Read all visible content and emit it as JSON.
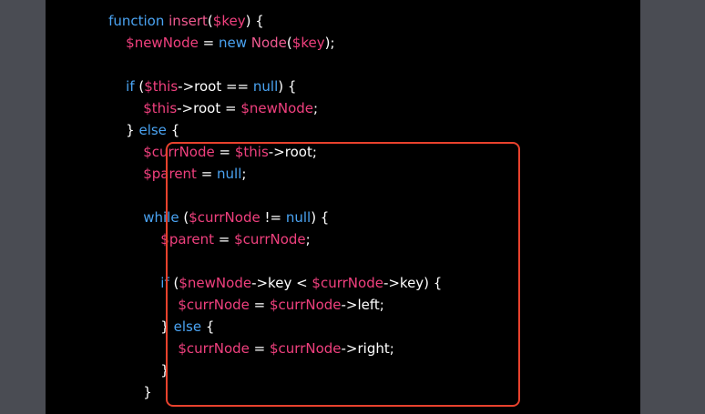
{
  "colors": {
    "background": "#4a4c53",
    "panel": "#000000",
    "keyword": "#4aa3f2",
    "function": "#f05a91",
    "variable": "#f0407e",
    "text": "#ffffff",
    "highlight_border": "#e8422d"
  },
  "code": {
    "lines": [
      {
        "indent": "    ",
        "tokens": [
          {
            "t": "function",
            "c": "kw"
          },
          {
            "t": " ",
            "c": "plain"
          },
          {
            "t": "insert",
            "c": "fn"
          },
          {
            "t": "(",
            "c": "plain"
          },
          {
            "t": "$key",
            "c": "var"
          },
          {
            "t": ") {",
            "c": "plain"
          }
        ]
      },
      {
        "indent": "        ",
        "tokens": [
          {
            "t": "$newNode",
            "c": "var"
          },
          {
            "t": " = ",
            "c": "plain"
          },
          {
            "t": "new",
            "c": "kw"
          },
          {
            "t": " ",
            "c": "plain"
          },
          {
            "t": "Node",
            "c": "fn"
          },
          {
            "t": "(",
            "c": "plain"
          },
          {
            "t": "$key",
            "c": "var"
          },
          {
            "t": ");",
            "c": "plain"
          }
        ]
      },
      {
        "indent": "",
        "tokens": []
      },
      {
        "indent": "        ",
        "tokens": [
          {
            "t": "if",
            "c": "kw"
          },
          {
            "t": " (",
            "c": "plain"
          },
          {
            "t": "$this",
            "c": "var"
          },
          {
            "t": "->root == ",
            "c": "plain"
          },
          {
            "t": "null",
            "c": "kw"
          },
          {
            "t": ") {",
            "c": "plain"
          }
        ]
      },
      {
        "indent": "            ",
        "tokens": [
          {
            "t": "$this",
            "c": "var"
          },
          {
            "t": "->root = ",
            "c": "plain"
          },
          {
            "t": "$newNode",
            "c": "var"
          },
          {
            "t": ";",
            "c": "plain"
          }
        ]
      },
      {
        "indent": "        ",
        "tokens": [
          {
            "t": "} ",
            "c": "plain"
          },
          {
            "t": "else",
            "c": "kw"
          },
          {
            "t": " {",
            "c": "plain"
          }
        ]
      },
      {
        "indent": "            ",
        "tokens": [
          {
            "t": "$currNode",
            "c": "var"
          },
          {
            "t": " = ",
            "c": "plain"
          },
          {
            "t": "$this",
            "c": "var"
          },
          {
            "t": "->root;",
            "c": "plain"
          }
        ]
      },
      {
        "indent": "            ",
        "tokens": [
          {
            "t": "$parent",
            "c": "var"
          },
          {
            "t": " = ",
            "c": "plain"
          },
          {
            "t": "null",
            "c": "kw"
          },
          {
            "t": ";",
            "c": "plain"
          }
        ]
      },
      {
        "indent": "",
        "tokens": []
      },
      {
        "indent": "            ",
        "tokens": [
          {
            "t": "while",
            "c": "kw"
          },
          {
            "t": " (",
            "c": "plain"
          },
          {
            "t": "$currNode",
            "c": "var"
          },
          {
            "t": " != ",
            "c": "plain"
          },
          {
            "t": "null",
            "c": "kw"
          },
          {
            "t": ") {",
            "c": "plain"
          }
        ]
      },
      {
        "indent": "                ",
        "tokens": [
          {
            "t": "$parent",
            "c": "var"
          },
          {
            "t": " = ",
            "c": "plain"
          },
          {
            "t": "$currNode",
            "c": "var"
          },
          {
            "t": ";",
            "c": "plain"
          }
        ]
      },
      {
        "indent": "",
        "tokens": []
      },
      {
        "indent": "                ",
        "tokens": [
          {
            "t": "if",
            "c": "kw"
          },
          {
            "t": " (",
            "c": "plain"
          },
          {
            "t": "$newNode",
            "c": "var"
          },
          {
            "t": "->key < ",
            "c": "plain"
          },
          {
            "t": "$currNode",
            "c": "var"
          },
          {
            "t": "->key) {",
            "c": "plain"
          }
        ]
      },
      {
        "indent": "                    ",
        "tokens": [
          {
            "t": "$currNode",
            "c": "var"
          },
          {
            "t": " = ",
            "c": "plain"
          },
          {
            "t": "$currNode",
            "c": "var"
          },
          {
            "t": "->left;",
            "c": "plain"
          }
        ]
      },
      {
        "indent": "                ",
        "tokens": [
          {
            "t": "} ",
            "c": "plain"
          },
          {
            "t": "else",
            "c": "kw"
          },
          {
            "t": " {",
            "c": "plain"
          }
        ]
      },
      {
        "indent": "                    ",
        "tokens": [
          {
            "t": "$currNode",
            "c": "var"
          },
          {
            "t": " = ",
            "c": "plain"
          },
          {
            "t": "$currNode",
            "c": "var"
          },
          {
            "t": "->right;",
            "c": "plain"
          }
        ]
      },
      {
        "indent": "                ",
        "tokens": [
          {
            "t": "}",
            "c": "plain"
          }
        ]
      },
      {
        "indent": "            ",
        "tokens": [
          {
            "t": "}",
            "c": "plain"
          }
        ]
      }
    ]
  }
}
